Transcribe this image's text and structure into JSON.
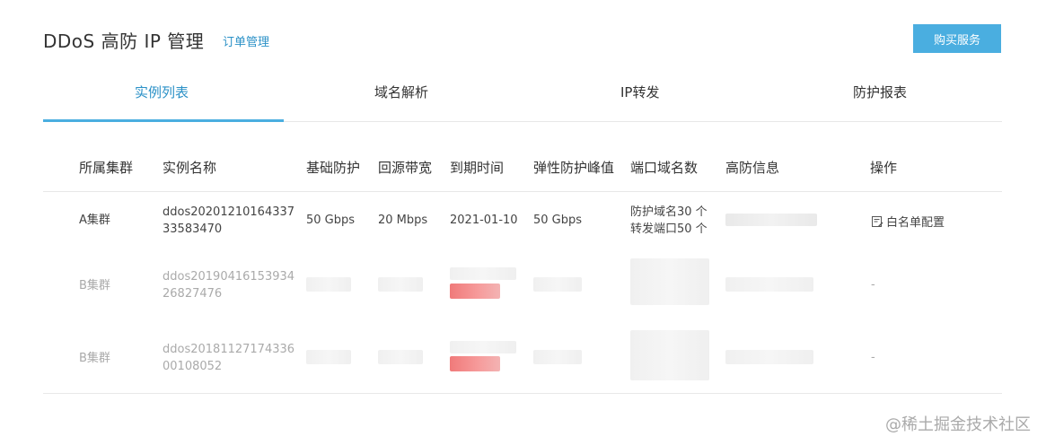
{
  "header": {
    "title": "DDoS 高防 IP 管理",
    "order_link": "订单管理",
    "buy_button": "购买服务"
  },
  "tabs": [
    {
      "label": "实例列表",
      "active": true
    },
    {
      "label": "域名解析",
      "active": false
    },
    {
      "label": "IP转发",
      "active": false
    },
    {
      "label": "防护报表",
      "active": false
    }
  ],
  "table": {
    "columns": [
      "所属集群",
      "实例名称",
      "基础防护",
      "回源带宽",
      "到期时间",
      "弹性防护峰值",
      "端口域名数",
      "高防信息",
      "操作"
    ],
    "rows": [
      {
        "cluster": "A集群",
        "name_line1": "ddos20201210164337",
        "name_line2": "33583470",
        "base_protection": "50 Gbps",
        "bandwidth": "20 Mbps",
        "expire": "2021-01-10",
        "elastic_peak": "50 Gbps",
        "ports_line1": "防护域名30 个",
        "ports_line2": "转发端口50 个",
        "action": "白名单配置"
      },
      {
        "cluster": "B集群",
        "name_line1": "ddos20190416153934",
        "name_line2": "26827476",
        "action": "-"
      },
      {
        "cluster": "B集群",
        "name_line1": "ddos20181127174336",
        "name_line2": "00108052",
        "action": "-"
      }
    ]
  },
  "watermark": "@稀土掘金技术社区",
  "colors": {
    "accent": "#4aaee0",
    "link": "#2b91c7",
    "expired_badge": "#f07a7a"
  },
  "icons": {
    "whitelist": "document-edit-icon"
  }
}
